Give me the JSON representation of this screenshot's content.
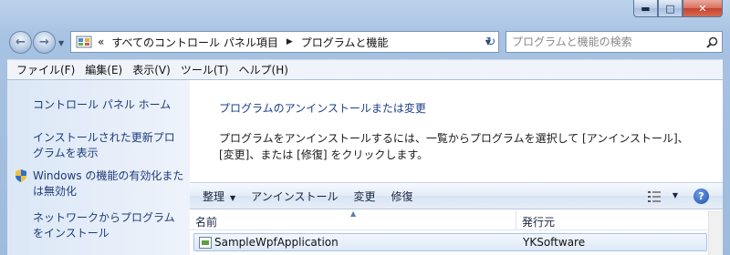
{
  "window": {
    "min_glyph": "▬",
    "max_glyph": "□",
    "close_glyph": "✕"
  },
  "nav": {
    "back_glyph": "←",
    "forward_glyph": "→",
    "history_dropdown_glyph": "▼",
    "breadcrumb_overflow": "«",
    "breadcrumb": [
      "すべてのコントロール パネル項目",
      "プログラムと機能"
    ],
    "breadcrumb_sep": "▶",
    "address_dropdown_glyph": "▼",
    "refresh_glyph": "↻",
    "search_placeholder": "プログラムと機能の検索",
    "search_icon": "search-icon"
  },
  "menu": [
    "ファイル(F)",
    "編集(E)",
    "表示(V)",
    "ツール(T)",
    "ヘルプ(H)"
  ],
  "tasks": {
    "home": "コントロール パネル ホーム",
    "updates_line1": "インストールされた更新プロ",
    "updates_line2": "グラムを表示",
    "features_line1": "Windows の機能の有効化また",
    "features_line2": "は無効化",
    "network_line1": "ネットワークからプログラム",
    "network_line2": "をインストール"
  },
  "content": {
    "heading": "プログラムのアンインストールまたは変更",
    "desc_line1": "プログラムをアンインストールするには、一覧からプログラムを選択して [アンインストール]、",
    "desc_line2": "[変更]、または [修復] をクリックします。"
  },
  "commands": {
    "organize": "整理",
    "organize_caret": "▼",
    "uninstall": "アンインストール",
    "change": "変更",
    "repair": "修復",
    "view_dropdown_glyph": "▼",
    "help_glyph": "?"
  },
  "columns": {
    "name": "名前",
    "sort_glyph": "▲",
    "publisher": "発行元"
  },
  "programs": [
    {
      "name": "SampleWpfApplication",
      "publisher": "YKSoftware"
    }
  ],
  "colors": {
    "link": "#1d3a78",
    "heading": "#1b3f87",
    "frame": "#a7c2e2",
    "close": "#c5422c"
  }
}
